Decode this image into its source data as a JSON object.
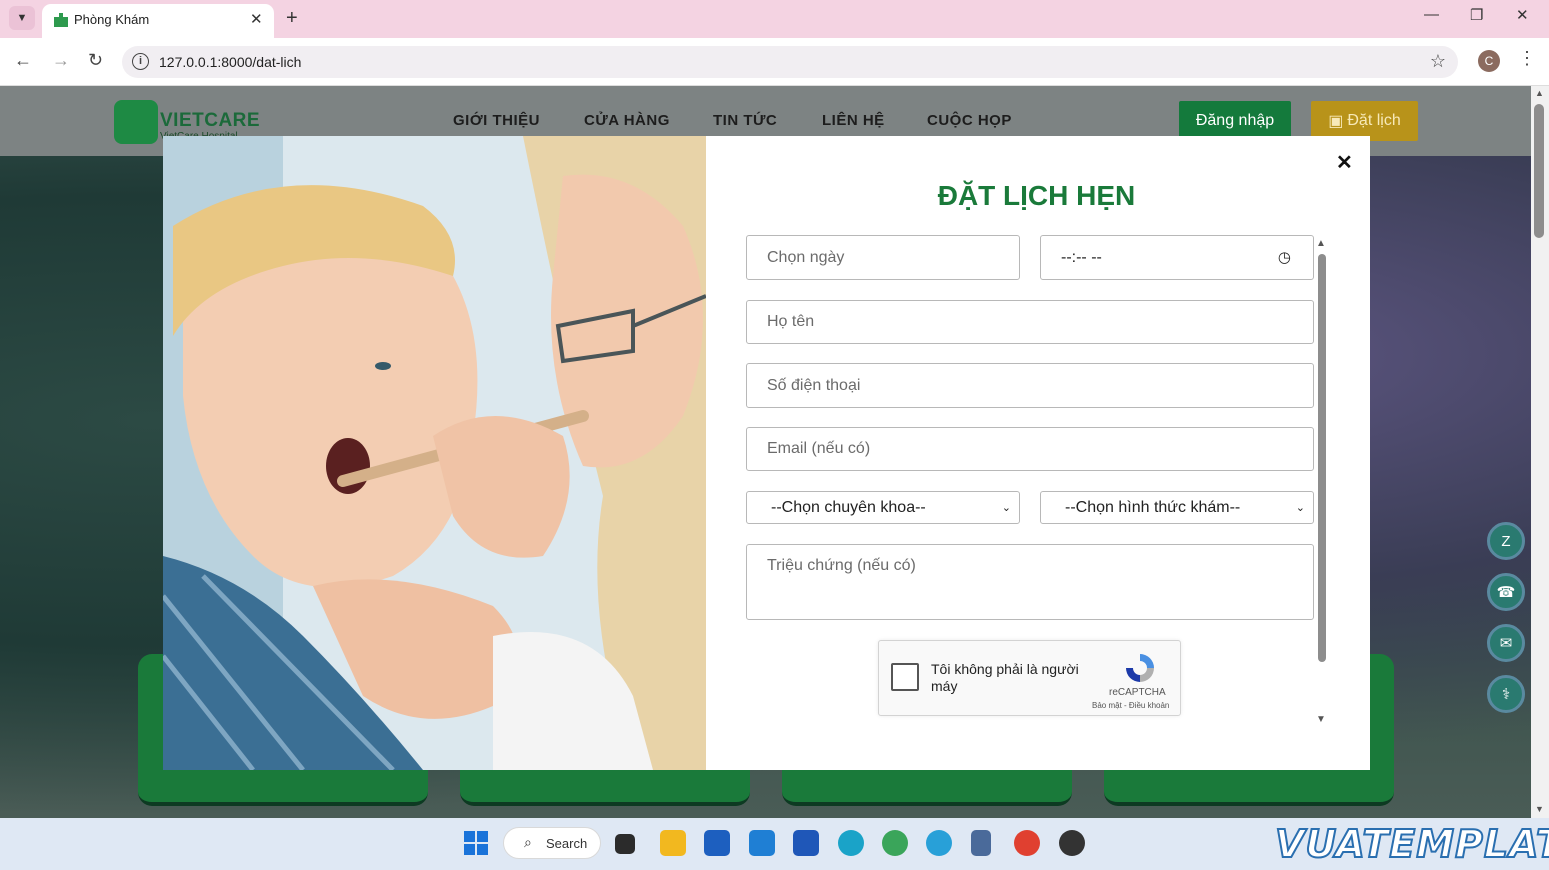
{
  "browser": {
    "tab_title": "Phòng Khám",
    "url": "127.0.0.1:8000/dat-lich",
    "profile_initial": "C"
  },
  "site": {
    "logo_name": "VIETCARE",
    "logo_subtitle": "VietCare Hospital",
    "nav": [
      "GIỚI THIỆU",
      "CỬA HÀNG",
      "TIN TỨC",
      "LIÊN HỆ",
      "CUỘC HỌP"
    ],
    "login_label": "Đăng nhập",
    "booking_label": "Đặt lịch"
  },
  "modal": {
    "title": "ĐẶT LỊCH HẸN",
    "date_placeholder": "Chọn ngày",
    "time_placeholder": "--:-- --",
    "name_placeholder": "Họ tên",
    "phone_placeholder": "Số điện thoại",
    "email_placeholder": "Email (nếu có)",
    "specialty_selected": "--Chọn chuyên khoa--",
    "exam_type_selected": "--Chọn hình thức khám--",
    "symptoms_placeholder": "Triệu chứng (nếu có)",
    "captcha": {
      "label": "Tôi không phải là người máy",
      "brand": "reCAPTCHA",
      "links": "Bảo mật - Điều khoản"
    }
  },
  "taskbar": {
    "search_label": "Search",
    "watermark": "VUATEMPLATE"
  },
  "colors": {
    "brand_green": "#1a7a3a",
    "booking_gold": "#b8931a",
    "tab_bar": "#f4d3e2"
  }
}
